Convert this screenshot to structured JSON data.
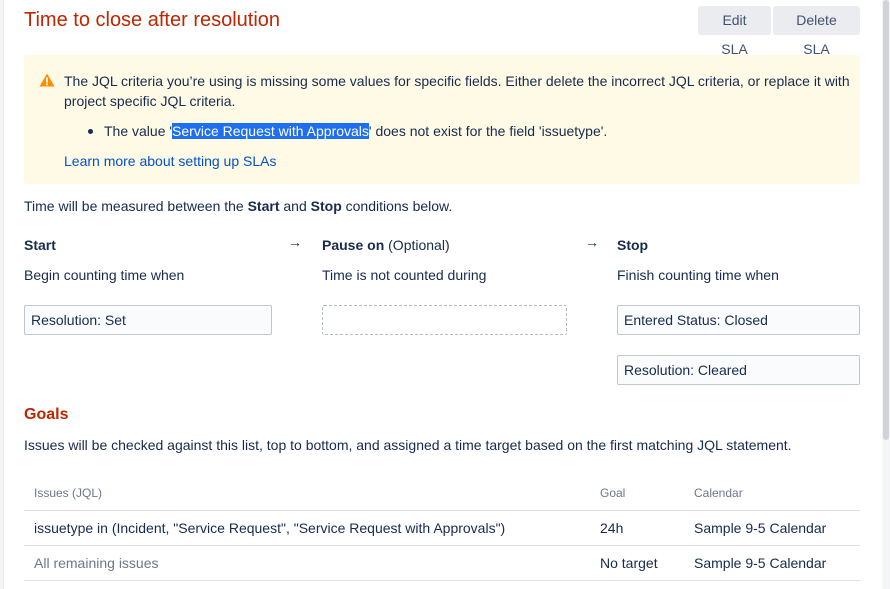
{
  "header": {
    "title": "Time to close after resolution",
    "edit_label": "Edit SLA",
    "delete_label": "Delete SLA"
  },
  "warning": {
    "message": "The JQL criteria you’re using is missing some values for specific fields. Either delete the incorrect JQL criteria, or replace it with project specific JQL criteria.",
    "bullet_prefix": "The value '",
    "bullet_value": "Service Request with Approvals",
    "bullet_suffix": "' does not exist for the field 'issuetype'.",
    "link": "Learn more about setting up SLAs",
    "icon": "warning-icon",
    "color": "#ff8b00"
  },
  "measure": {
    "prefix": "Time will be measured between the ",
    "start_word": "Start",
    "middle": " and ",
    "stop_word": "Stop",
    "suffix": " conditions below."
  },
  "conditions": {
    "start": {
      "title": "Start",
      "description": "Begin counting time when",
      "items": [
        "Resolution: Set"
      ]
    },
    "pause": {
      "title": "Pause on",
      "optional": "(Optional)",
      "description": "Time is not counted during",
      "items": []
    },
    "stop": {
      "title": "Stop",
      "description": "Finish counting time when",
      "items": [
        "Entered Status: Closed",
        "Resolution: Cleared"
      ]
    },
    "arrow": "→"
  },
  "goals": {
    "title": "Goals",
    "description": "Issues will be checked against this list, top to bottom, and assigned a time target based on the first matching JQL statement.",
    "columns": [
      "Issues (JQL)",
      "Goal",
      "Calendar"
    ],
    "rows": [
      {
        "issues": "issuetype in (Incident, \"Service Request\", \"Service Request with Approvals\")",
        "goal": "24h",
        "calendar": "Sample 9-5 Calendar"
      },
      {
        "issues": "All remaining issues",
        "goal": "No target",
        "calendar": "Sample 9-5 Calendar"
      }
    ]
  },
  "colors": {
    "title": "#bf2600",
    "link": "#0052cc",
    "highlight": "#1e6ff0",
    "warning_bg": "#fffae6"
  }
}
